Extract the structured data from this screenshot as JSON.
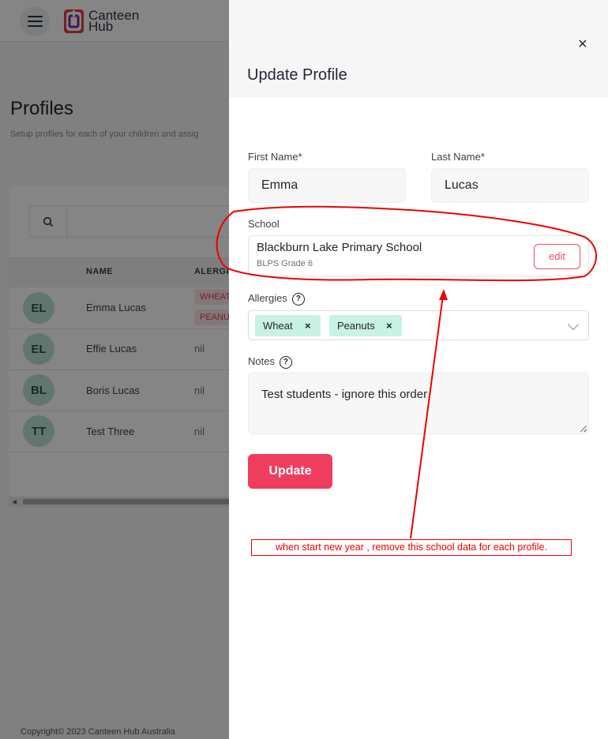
{
  "app": {
    "logo_line1": "Canteen",
    "logo_line2": "Hub",
    "brand_colors": {
      "red": "#e63a4a",
      "purple": "#7b2e9e"
    }
  },
  "page": {
    "title": "Profiles",
    "subtitle": "Setup profiles for each of your children and assig"
  },
  "table": {
    "headers": {
      "name": "NAME",
      "allergies": "ALERGI"
    },
    "rows": [
      {
        "initials": "EL",
        "name": "Emma Lucas",
        "allergies": [
          "WHEAT",
          "PEANU"
        ]
      },
      {
        "initials": "EL",
        "name": "Effie Lucas",
        "allergies_text": "nil"
      },
      {
        "initials": "BL",
        "name": "Boris Lucas",
        "allergies_text": "nil"
      },
      {
        "initials": "TT",
        "name": "Test Three",
        "allergies_text": "nil"
      }
    ]
  },
  "footer": {
    "copyright": "Copyright© 2023 Canteen Hub Australia"
  },
  "drawer": {
    "title": "Update Profile",
    "close": "×",
    "first_name_label": "First Name*",
    "first_name_value": "Emma",
    "last_name_label": "Last Name*",
    "last_name_value": "Lucas",
    "school_label": "School",
    "school_name": "Blackburn Lake Primary School",
    "school_grade": "BLPS Grade 6",
    "edit_label": "edit",
    "allergies_label": "Allergies",
    "help_glyph": "?",
    "allergy_chips": [
      "Wheat",
      "Peanuts"
    ],
    "chip_remove": "×",
    "notes_label": "Notes",
    "notes_value": "Test students - ignore this order",
    "update_label": "Update"
  },
  "annotation": {
    "text": "when start new year , remove this school data for each profile.",
    "color": "#e00000"
  }
}
